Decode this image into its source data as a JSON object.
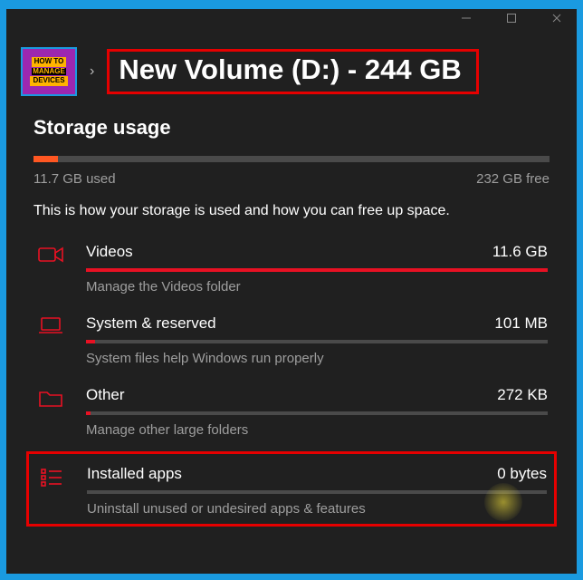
{
  "logo": {
    "line1": "HOW TO",
    "line2": "MANAGE",
    "line3": "DEVICES"
  },
  "header": {
    "breadcrumb_chevron": "›",
    "title": "New Volume (D:) - 244 GB"
  },
  "storage": {
    "heading": "Storage usage",
    "used_label": "11.7 GB used",
    "free_label": "232 GB free",
    "used_percent": 4.8,
    "description": "This is how your storage is used and how you can free up space."
  },
  "categories": [
    {
      "icon": "video",
      "name": "Videos",
      "size": "11.6 GB",
      "sub": "Manage the Videos folder",
      "fill_percent": 100
    },
    {
      "icon": "laptop",
      "name": "System & reserved",
      "size": "101 MB",
      "sub": "System files help Windows run properly",
      "fill_percent": 2
    },
    {
      "icon": "folder",
      "name": "Other",
      "size": "272 KB",
      "sub": "Manage other large folders",
      "fill_percent": 1
    },
    {
      "icon": "apps",
      "name": "Installed apps",
      "size": "0 bytes",
      "sub": "Uninstall unused or undesired apps & features",
      "fill_percent": 0,
      "highlight": true
    }
  ]
}
